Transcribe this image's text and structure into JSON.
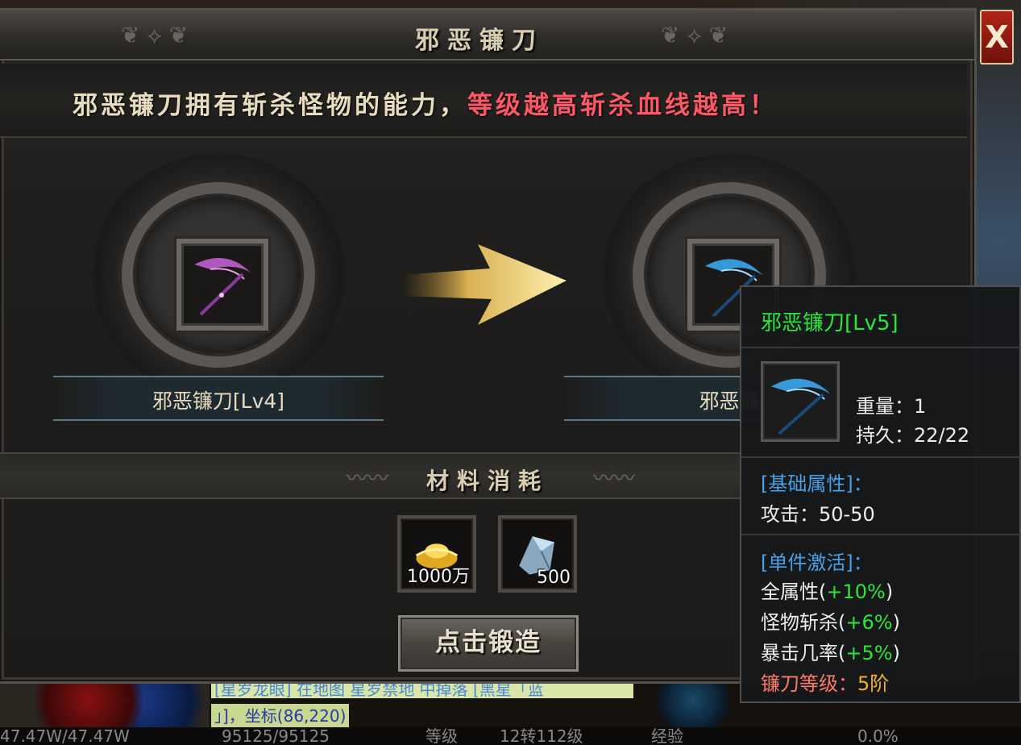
{
  "dialog": {
    "title": "邪恶镰刀",
    "close_label": "X",
    "description_part1": "邪恶镰刀拥有斩杀怪物的能力，",
    "description_part2": "等级越高斩杀血线越高！"
  },
  "upgrade": {
    "from_name": "邪恶镰刀[Lv4]",
    "to_name": "邪恶镰"
  },
  "materials": {
    "header": "材料消耗",
    "items": [
      {
        "icon": "gold-ingot-icon",
        "count": "1000万"
      },
      {
        "icon": "crystal-ore-icon",
        "count": "500"
      }
    ],
    "forge_button": "点击锻造"
  },
  "tooltip": {
    "title": "邪恶镰刀[Lv5]",
    "weight_label": "重量：",
    "weight_value": "1",
    "durability_label": "持久：",
    "durability_value": "22/22",
    "base_header": "[基础属性]：",
    "attack_label": "攻击：",
    "attack_value": "50-50",
    "set_header": "[单件激活]：",
    "stats": [
      {
        "label": "全属性(",
        "value": "+10%",
        "close": ")"
      },
      {
        "label": "怪物斩杀(",
        "value": "+6%",
        "close": ")"
      },
      {
        "label": "暴击几率(",
        "value": "+5%",
        "close": ")"
      }
    ],
    "level_label": "镰刀等级：",
    "level_value": "5阶"
  },
  "hud": {
    "chat_line1": "[星岁龙眼] 在地图 星岁禁地 中掉落 [黑星「蓝",
    "chat_line2": "」]，坐标(86,220)",
    "hp": "47.47W/47.47W",
    "mp": "95125/95125",
    "level_label": "等级",
    "level_value": "12转112级",
    "exp_label": "经验",
    "exp_value": "0.0%"
  },
  "colors": {
    "title_gold": "#d8cdb0",
    "highlight_red": "#ff5866",
    "tooltip_green": "#2ee63a",
    "tooltip_blue": "#48a0e8",
    "close_red": "#b02418"
  }
}
